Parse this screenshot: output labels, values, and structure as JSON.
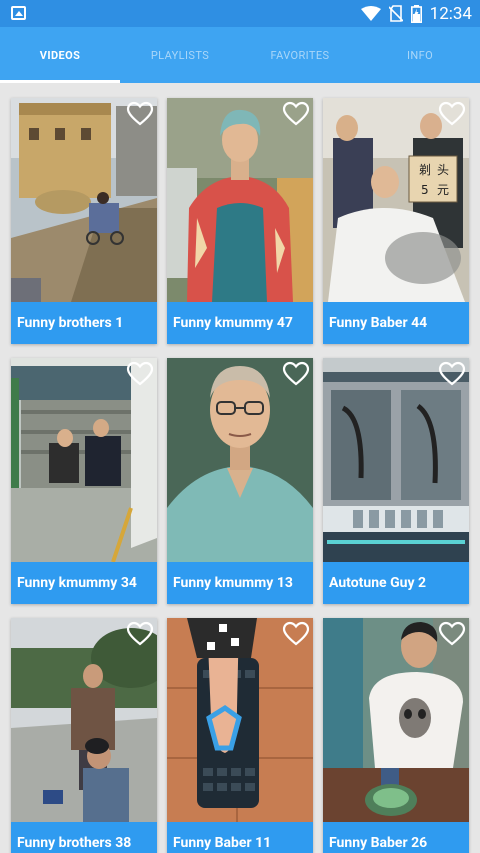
{
  "status_bar": {
    "time": "12:34"
  },
  "tabs": [
    {
      "label": "VIDEOS",
      "active": true
    },
    {
      "label": "PLAYLISTS",
      "active": false
    },
    {
      "label": "FAVORITES",
      "active": false
    },
    {
      "label": "INFO",
      "active": false
    }
  ],
  "videos": [
    {
      "title": "Funny brothers 1"
    },
    {
      "title": "Funny kmummy 47"
    },
    {
      "title": "Funny Baber 44"
    },
    {
      "title": "Funny kmummy 34"
    },
    {
      "title": "Funny kmummy 13"
    },
    {
      "title": "Autotune Guy 2"
    },
    {
      "title": "Funny brothers 38"
    },
    {
      "title": "Funny Baber 11"
    },
    {
      "title": "Funny Baber 26"
    }
  ],
  "thumbnail_sign_text": [
    "剃",
    "头",
    "5",
    "元"
  ],
  "colors": {
    "status_bar": "#2f8fe3",
    "tab_bar": "#3ea4f2",
    "card_caption": "#2f9bf0",
    "background": "#e6e6e6"
  }
}
